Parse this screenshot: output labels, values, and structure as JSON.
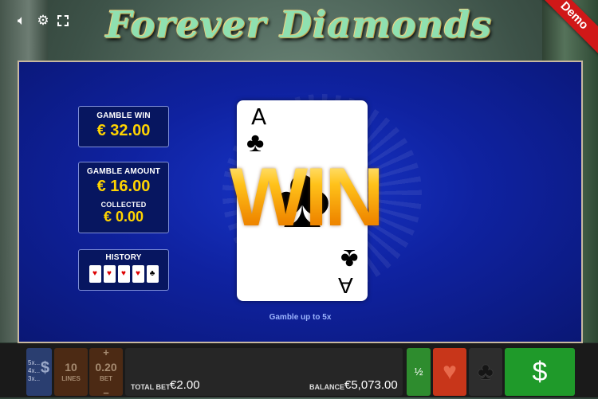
{
  "header": {
    "logo_text": "Forever Diamonds",
    "demo_label": "Demo",
    "icons": [
      "speaker-icon",
      "gear-icon",
      "fullscreen-icon"
    ]
  },
  "gamble": {
    "gamble_win_label": "GAMBLE WIN",
    "gamble_win_value": "€ 32.00",
    "gamble_amount_label": "GAMBLE AMOUNT",
    "gamble_amount_value": "€ 16.00",
    "collected_label": "COLLECTED",
    "collected_value": "€ 0.00",
    "history_label": "HISTORY",
    "history": [
      {
        "suit": "♥",
        "color": "red"
      },
      {
        "suit": "♥",
        "color": "red"
      },
      {
        "suit": "♥",
        "color": "red"
      },
      {
        "suit": "♥",
        "color": "red"
      },
      {
        "suit": "♣",
        "color": "black"
      }
    ],
    "card": {
      "rank": "A",
      "suit": "♣"
    },
    "win_text": "WIN",
    "hint": "Gamble up to 5x"
  },
  "bottom": {
    "lines_list": [
      "5x...",
      "4x...",
      "3x..."
    ],
    "lines_value": "10",
    "lines_label": "LINES",
    "bet_value": "0.20",
    "bet_label": "BET",
    "plus": "+",
    "minus": "−",
    "total_bet_label": "TOTAL BET",
    "total_bet_value": "€2.00",
    "balance_label": "BALANCE",
    "balance_value": "€5,073.00",
    "half_label": "½",
    "red_suit": "♥",
    "black_suit": "♣",
    "collect_icon": "$"
  }
}
